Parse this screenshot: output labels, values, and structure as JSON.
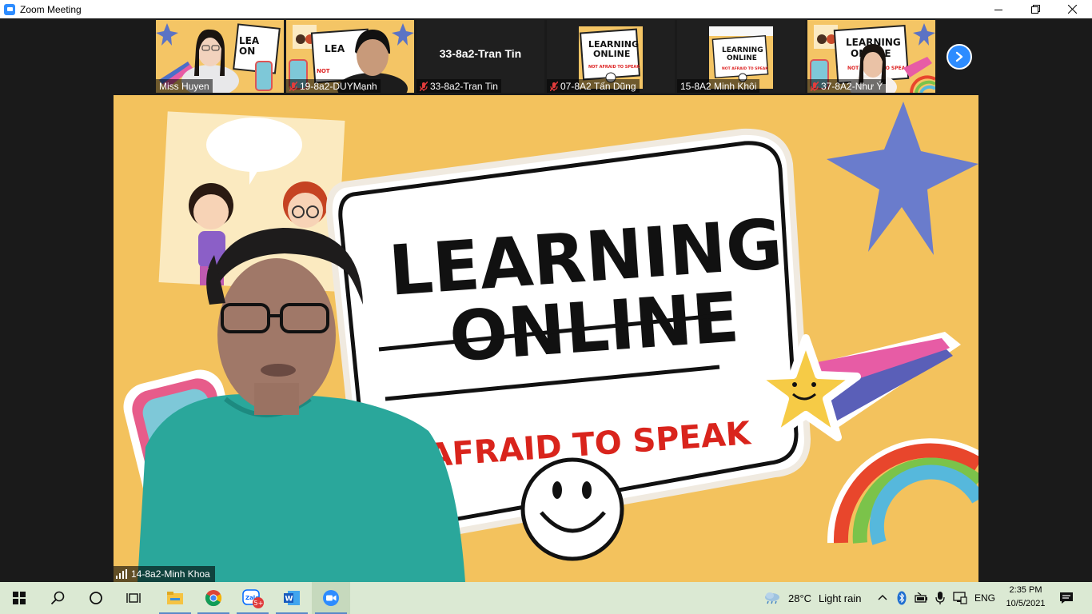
{
  "window": {
    "title": "Zoom Meeting",
    "app_icon": "zoom-logo-icon",
    "controls": [
      "minimize-icon",
      "restore-icon",
      "close-icon"
    ]
  },
  "gallery": {
    "participants": [
      {
        "name": "Miss Huyen",
        "muted": false,
        "video": true
      },
      {
        "name": "19-8a2-DUYMạnh",
        "muted": true,
        "video": true
      },
      {
        "name": "33-8a2-Tran Tin",
        "muted": true,
        "video": false,
        "display_name": "33-8a2-Tran Tin"
      },
      {
        "name": "07-8A2 Tấn Dũng",
        "muted": true,
        "video": true
      },
      {
        "name": "15-8A2 Minh Khôi",
        "muted": false,
        "video": true
      },
      {
        "name": "37-8A2-Như Ý",
        "muted": true,
        "video": true
      }
    ],
    "next_button_icon": "chevron-right-icon"
  },
  "active_speaker": {
    "name": "14-8a2-Minh Khoa",
    "signal_icon": "signal-bars-icon",
    "slide": {
      "line1": "LEARNING",
      "line2": "ONLINE",
      "tagline": "AFRAID TO SPEAK",
      "mini_tagline": "NOT AFRAID TO SPEAK"
    }
  },
  "taskbar": {
    "icons": [
      "windows-start-icon",
      "search-icon",
      "cortana-icon",
      "task-view-icon",
      "file-explorer-icon",
      "chrome-icon",
      "zalo-icon",
      "word-icon",
      "zoom-icon"
    ],
    "zalo_badge": "5+",
    "weather": {
      "temp": "28°C",
      "condition": "Light rain",
      "icon": "weather-cloud-rain-icon"
    },
    "tray_icons": [
      "chevron-up-icon",
      "bluetooth-icon",
      "battery-icon",
      "microphone-icon",
      "network-icon"
    ],
    "language": "ENG",
    "time": "2:35 PM",
    "date": "10/5/2021",
    "notification_icon": "notification-icon",
    "colors": {
      "taskbar": "#dbe9d3",
      "zoom_blue": "#2d8cff",
      "slide_yellow": "#f3c25d"
    }
  }
}
